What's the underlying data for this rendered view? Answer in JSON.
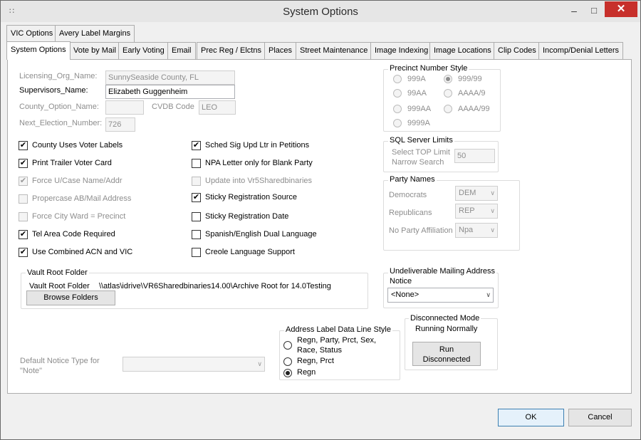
{
  "window": {
    "title": "System Options",
    "min_glyph": "–",
    "max_glyph": "□",
    "close_glyph": "✕",
    "sysicon_glyph": "∷"
  },
  "tabs_row1": [
    "VIC Options",
    "Avery Label Margins"
  ],
  "tabs_row2": [
    "System Options",
    "Vote by Mail",
    "Early Voting",
    "Email",
    "Prec Reg / Elctns",
    "Places",
    "Street Maintenance",
    "Image Indexing",
    "Image Locations",
    "Clip Codes",
    "Incomp/Denial Letters"
  ],
  "fields": {
    "licensing_org_label": "Licensing_Org_Name:",
    "licensing_org_value": "SunnySeaside County, FL",
    "supervisors_label": "Supervisors_Name:",
    "supervisors_value": "Elizabeth Guggenheim",
    "county_option_label": "County_Option_Name:",
    "county_option_value": "",
    "cvdb_label": "CVDB Code",
    "cvdb_value": "LEO",
    "next_election_label": "Next_Election_Number:",
    "next_election_value": "726"
  },
  "checkboxes_left": [
    {
      "label": "County Uses Voter Labels",
      "checked": true,
      "disabled": false
    },
    {
      "label": "Print Trailer Voter Card",
      "checked": true,
      "disabled": false
    },
    {
      "label": "Force U/Case Name/Addr",
      "checked": true,
      "disabled": true
    },
    {
      "label": "Propercase AB/Mail Address",
      "checked": false,
      "disabled": true
    },
    {
      "label": "Force City Ward = Precinct",
      "checked": false,
      "disabled": true
    },
    {
      "label": "Tel Area Code Required",
      "checked": true,
      "disabled": false
    },
    {
      "label": "Use Combined ACN and VIC",
      "checked": true,
      "disabled": false
    }
  ],
  "checkboxes_right": [
    {
      "label": "Sched Sig Upd Ltr in Petitions",
      "checked": true,
      "disabled": false
    },
    {
      "label": "NPA Letter only for Blank Party",
      "checked": false,
      "disabled": false
    },
    {
      "label": "Update into Vr5Sharedbinaries",
      "checked": false,
      "disabled": true
    },
    {
      "label": "Sticky Registration Source",
      "checked": true,
      "disabled": false
    },
    {
      "label": "Sticky Registration Date",
      "checked": false,
      "disabled": false
    },
    {
      "label": "Spanish/English Dual Language",
      "checked": false,
      "disabled": false
    },
    {
      "label": "Creole Language Support",
      "checked": false,
      "disabled": false
    }
  ],
  "precinct_style": {
    "title": "Precinct Number Style",
    "options": [
      "999A",
      "999/99",
      "99AA",
      "AAAA/9",
      "999AA",
      "AAAA/99",
      "9999A"
    ],
    "selected": "999/99"
  },
  "sql_limits": {
    "title": "SQL Server Limits",
    "label_line1": "Select TOP Limit",
    "label_line2": "Narrow Search",
    "value": "50"
  },
  "party_names": {
    "title": "Party Names",
    "rows": [
      {
        "label": "Democrats",
        "value": "DEM"
      },
      {
        "label": "Republicans",
        "value": "REP"
      },
      {
        "label": "No Party Affiliation",
        "value": "Npa"
      }
    ]
  },
  "vault": {
    "title": "Vault Root Folder",
    "label": "Vault Root Folder",
    "path": "\\\\atlas\\idrive\\VR6Sharedbinaries14.00\\Archive Root for 14.0Testing",
    "browse_label": "Browse Folders"
  },
  "undeliverable": {
    "title_line1": "Undeliverable Mailing Address",
    "title_line2": "Notice",
    "value": "<None>"
  },
  "disconnected": {
    "title": "Disconnected Mode",
    "status": "Running Normally",
    "button_line1": "Run",
    "button_line2": "Disconnected"
  },
  "address_label": {
    "title": "Address Label Data Line Style",
    "options": [
      {
        "line1": "Regn, Party, Prct, Sex,",
        "line2": "Race, Status"
      },
      {
        "line1": "Regn, Prct",
        "line2": ""
      },
      {
        "line1": "Regn",
        "line2": ""
      }
    ],
    "selected_index": 2
  },
  "default_notice": {
    "label_line1": "Default Notice Type for",
    "label_line2": "\"Note\"",
    "value": ""
  },
  "footer": {
    "ok_label": "OK",
    "cancel_label": "Cancel"
  }
}
